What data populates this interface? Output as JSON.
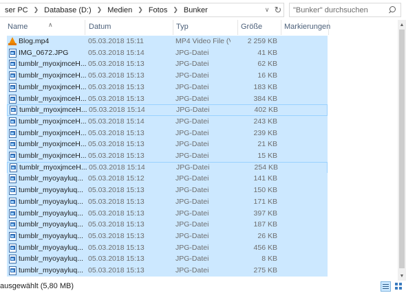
{
  "address": {
    "crumbs": [
      "ser PC",
      "Database (D:)",
      "Medien",
      "Fotos",
      "Bunker"
    ],
    "dropdown_icon": "chevron-down-icon",
    "refresh_icon": "refresh-icon"
  },
  "search": {
    "placeholder": "\"Bunker\" durchsuchen",
    "icon": "search-icon"
  },
  "columns": {
    "name": "Name",
    "date": "Datum",
    "type": "Typ",
    "size": "Größe",
    "tags": "Markierungen"
  },
  "files": [
    {
      "name": "Blog.mp4",
      "date": "05.03.2018 15:11",
      "type": "MP4 Video File (V",
      "size": "2 259 KB",
      "icon": "vlc-video-icon"
    },
    {
      "name": "IMG_0672.JPG",
      "date": "05.03.2018 15:14",
      "type": "JPG-Datei",
      "size": "41 KB",
      "icon": "jpg-file-icon"
    },
    {
      "name": "tumblr_myoxjmceH...",
      "date": "05.03.2018 15:13",
      "type": "JPG-Datei",
      "size": "62 KB",
      "icon": "jpg-file-icon"
    },
    {
      "name": "tumblr_myoxjmceH...",
      "date": "05.03.2018 15:13",
      "type": "JPG-Datei",
      "size": "16 KB",
      "icon": "jpg-file-icon"
    },
    {
      "name": "tumblr_myoxjmceH...",
      "date": "05.03.2018 15:13",
      "type": "JPG-Datei",
      "size": "183 KB",
      "icon": "jpg-file-icon"
    },
    {
      "name": "tumblr_myoxjmceH...",
      "date": "05.03.2018 15:13",
      "type": "JPG-Datei",
      "size": "384 KB",
      "icon": "jpg-file-icon"
    },
    {
      "name": "tumblr_myoxjmceH...",
      "date": "05.03.2018 15:14",
      "type": "JPG-Datei",
      "size": "402 KB",
      "icon": "jpg-file-icon"
    },
    {
      "name": "tumblr_myoxjmceH...",
      "date": "05.03.2018 15:14",
      "type": "JPG-Datei",
      "size": "243 KB",
      "icon": "jpg-file-icon"
    },
    {
      "name": "tumblr_myoxjmceH...",
      "date": "05.03.2018 15:13",
      "type": "JPG-Datei",
      "size": "239 KB",
      "icon": "jpg-file-icon"
    },
    {
      "name": "tumblr_myoxjmceH...",
      "date": "05.03.2018 15:13",
      "type": "JPG-Datei",
      "size": "21 KB",
      "icon": "jpg-file-icon"
    },
    {
      "name": "tumblr_myoxjmceH...",
      "date": "05.03.2018 15:13",
      "type": "JPG-Datei",
      "size": "15 KB",
      "icon": "jpg-file-icon"
    },
    {
      "name": "tumblr_myoxjmceH...",
      "date": "05.03.2018 15:14",
      "type": "JPG-Datei",
      "size": "254 KB",
      "icon": "jpg-file-icon"
    },
    {
      "name": "tumblr_myoyayluq...",
      "date": "05.03.2018 15:12",
      "type": "JPG-Datei",
      "size": "141 KB",
      "icon": "jpg-file-icon"
    },
    {
      "name": "tumblr_myoyayluq...",
      "date": "05.03.2018 15:13",
      "type": "JPG-Datei",
      "size": "150 KB",
      "icon": "jpg-file-icon"
    },
    {
      "name": "tumblr_myoyayluq...",
      "date": "05.03.2018 15:13",
      "type": "JPG-Datei",
      "size": "171 KB",
      "icon": "jpg-file-icon"
    },
    {
      "name": "tumblr_myoyayluq...",
      "date": "05.03.2018 15:13",
      "type": "JPG-Datei",
      "size": "397 KB",
      "icon": "jpg-file-icon"
    },
    {
      "name": "tumblr_myoyayluq...",
      "date": "05.03.2018 15:13",
      "type": "JPG-Datei",
      "size": "187 KB",
      "icon": "jpg-file-icon"
    },
    {
      "name": "tumblr_myoyayluq...",
      "date": "05.03.2018 15:13",
      "type": "JPG-Datei",
      "size": "26 KB",
      "icon": "jpg-file-icon"
    },
    {
      "name": "tumblr_myoyayluq...",
      "date": "05.03.2018 15:13",
      "type": "JPG-Datei",
      "size": "456 KB",
      "icon": "jpg-file-icon"
    },
    {
      "name": "tumblr_myoyayluq...",
      "date": "05.03.2018 15:13",
      "type": "JPG-Datei",
      "size": "8 KB",
      "icon": "jpg-file-icon"
    },
    {
      "name": "tumblr_myoyayluq...",
      "date": "05.03.2018 15:13",
      "type": "JPG-Datei",
      "size": "275 KB",
      "icon": "jpg-file-icon"
    }
  ],
  "focused_rows": [
    6,
    11
  ],
  "colors": {
    "selection": "#cce8ff",
    "focus_border": "#99d1ff",
    "header_text": "#4c607a"
  },
  "status": {
    "text": "ausgewählt (5,80 MB)"
  },
  "views": {
    "details_icon": "details-view-icon",
    "tiles_icon": "large-icons-view-icon"
  }
}
